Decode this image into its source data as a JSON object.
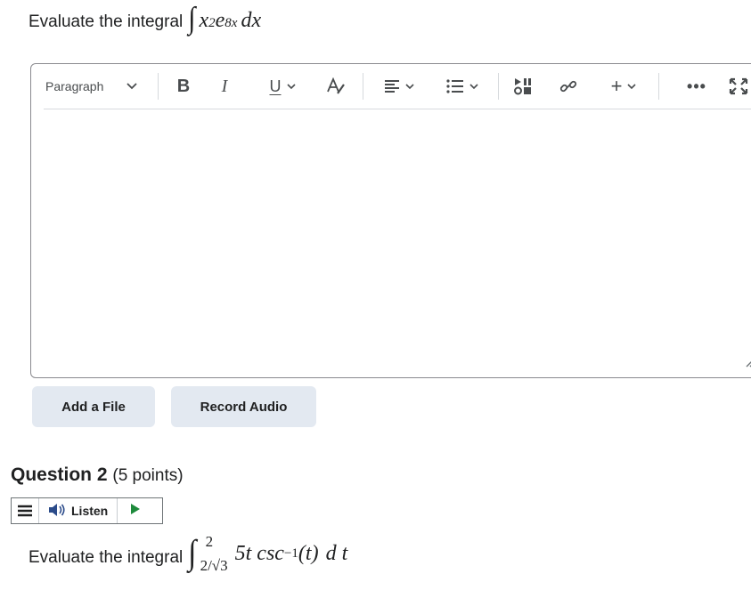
{
  "question1": {
    "prompt_text": "Evaluate the integral",
    "integrand_base": "x",
    "integrand_power": "2",
    "integrand_exp_base": "e",
    "integrand_exp_power": "8x",
    "differential": "dx"
  },
  "editor": {
    "toolbar": {
      "paragraph_label": "Paragraph",
      "bold_label": "B",
      "italic_label": "I",
      "underline_label": "U",
      "plus_label": "+",
      "more_label": "•••"
    },
    "content": ""
  },
  "buttons": {
    "add_file": "Add a File",
    "record_audio": "Record Audio"
  },
  "question2": {
    "heading": "Question 2",
    "points": "(5 points)",
    "listen_label": "Listen",
    "prompt_text": "Evaluate the integral",
    "upper_limit": "2",
    "lower_limit": "2/√3",
    "coefficient": "5",
    "variable": "t",
    "function": "csc",
    "inverse_power": "−1",
    "argument": "(t)",
    "differential_d": "d",
    "differential_var": "t"
  },
  "colors": {
    "button_bg": "#e3e9f1",
    "border": "#8a8a8f",
    "play_green": "#1e8a3c",
    "text": "#202122"
  },
  "icons": [
    "chevron-down-icon",
    "text-color-icon",
    "align-icon",
    "bullet-list-icon",
    "media-icon",
    "link-icon",
    "fullscreen-icon",
    "resize-handle-icon",
    "menu-icon",
    "speaker-icon",
    "play-icon"
  ]
}
